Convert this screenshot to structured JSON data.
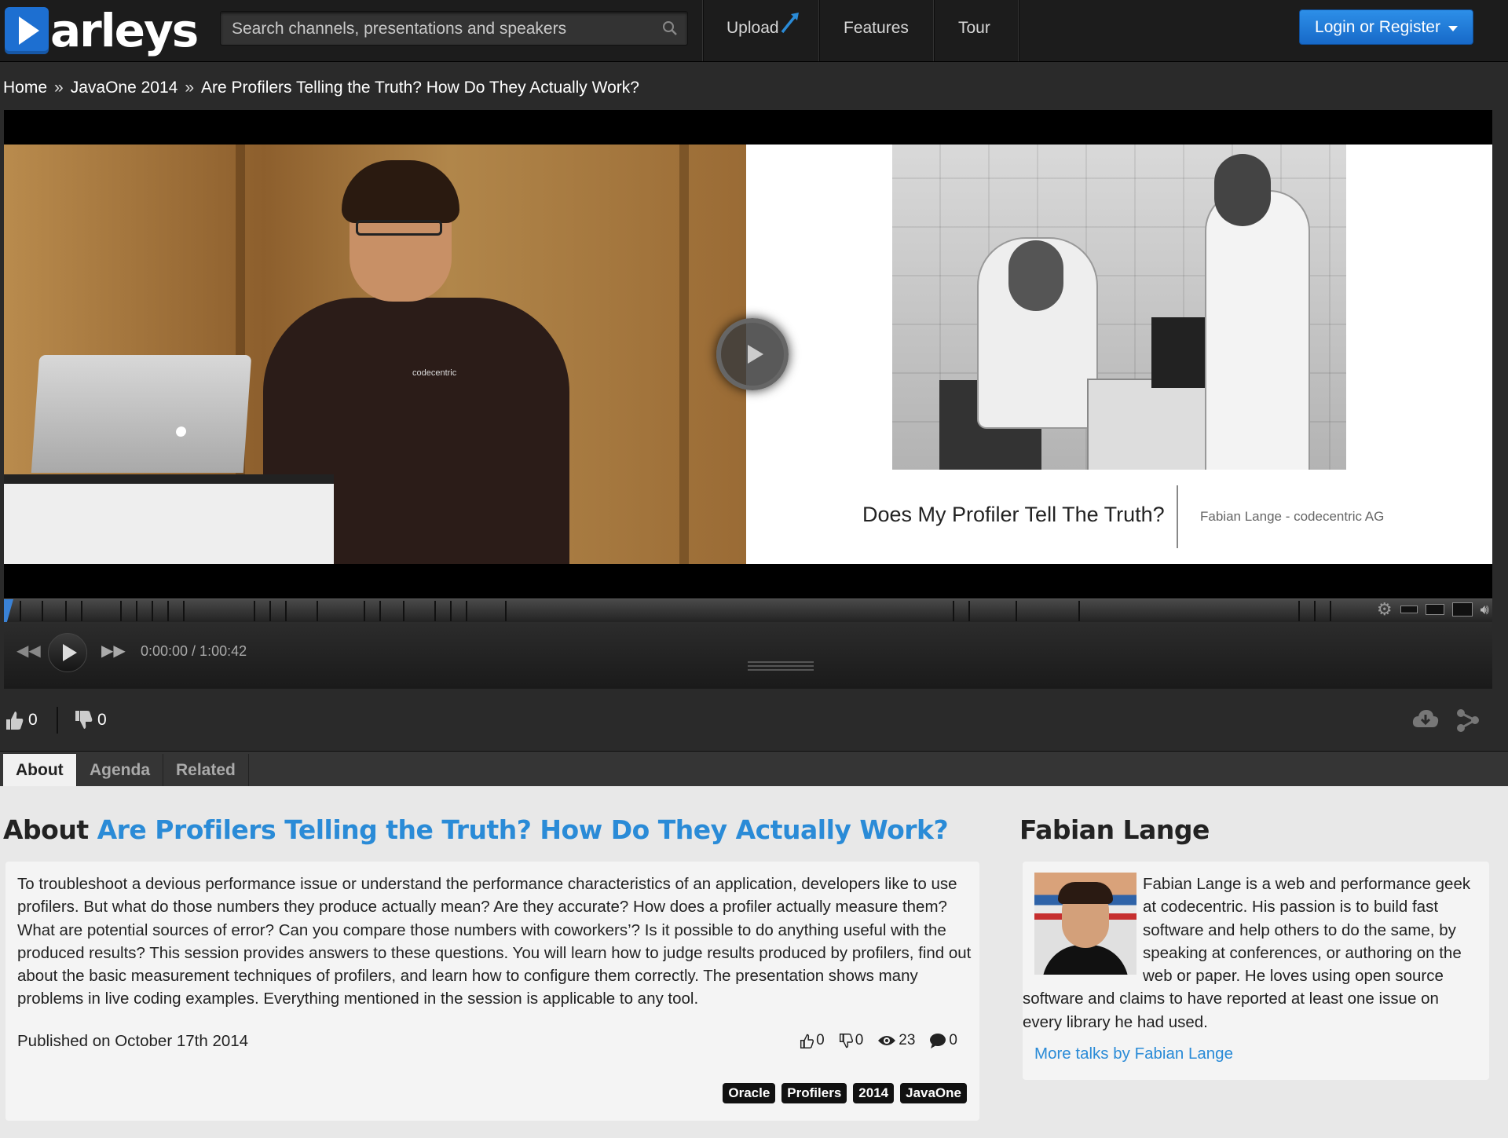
{
  "header": {
    "logo_text": "arleys",
    "search_placeholder": "Search channels, presentations and speakers",
    "nav": [
      "Upload",
      "Features",
      "Tour"
    ],
    "login_label": "Login or Register"
  },
  "breadcrumb": [
    "Home",
    "JavaOne 2014",
    "Are Profilers Telling the Truth? How Do They Actually Work?"
  ],
  "player": {
    "shirt_logo": "codecentric",
    "slide_title": "Does My Profiler Tell The Truth?",
    "slide_author": "Fabian Lange - codecentric AG",
    "time": "0:00:00 / 1:00:42",
    "progress_percent": 0
  },
  "votes": {
    "likes": "0",
    "dislikes": "0"
  },
  "tabs": [
    "About",
    "Agenda",
    "Related"
  ],
  "about": {
    "heading_prefix": "About",
    "title": "Are Profilers Telling the Truth? How Do They Actually Work?",
    "description": "To troubleshoot a devious performance issue or understand the performance characteristics of an application, developers like to use profilers. But what do those numbers they produce actually mean? Are they accurate? How does a profiler actually measure them? What are potential sources of error? Can you compare those numbers with coworkers’? Is it possible to do anything useful with the produced results? This session provides answers to these questions. You will learn how to judge results produced by profilers, find out about the basic measurement techniques of profilers, and learn how to configure them correctly. The presentation shows many problems in live coding examples. Everything mentioned in the session is applicable to any tool.",
    "published": "Published on October 17th 2014",
    "stats": {
      "likes": "0",
      "dislikes": "0",
      "views": "23",
      "comments": "0"
    },
    "tags": [
      "Oracle",
      "Profilers",
      "2014",
      "JavaOne"
    ]
  },
  "speaker": {
    "name": "Fabian Lange",
    "bio": "Fabian Lange is a web and performance geek at codecentric. His passion is to build fast software and help others to do the same, by speaking at conferences, or authoring on the web or paper. He loves using open source software and claims to have reported at least one issue on every library he had used.",
    "more_link": "More talks by Fabian Lange"
  },
  "colors": {
    "accent": "#2a8bd7",
    "login_button": "#1d74d6",
    "topbar": "#1c1c1c"
  }
}
